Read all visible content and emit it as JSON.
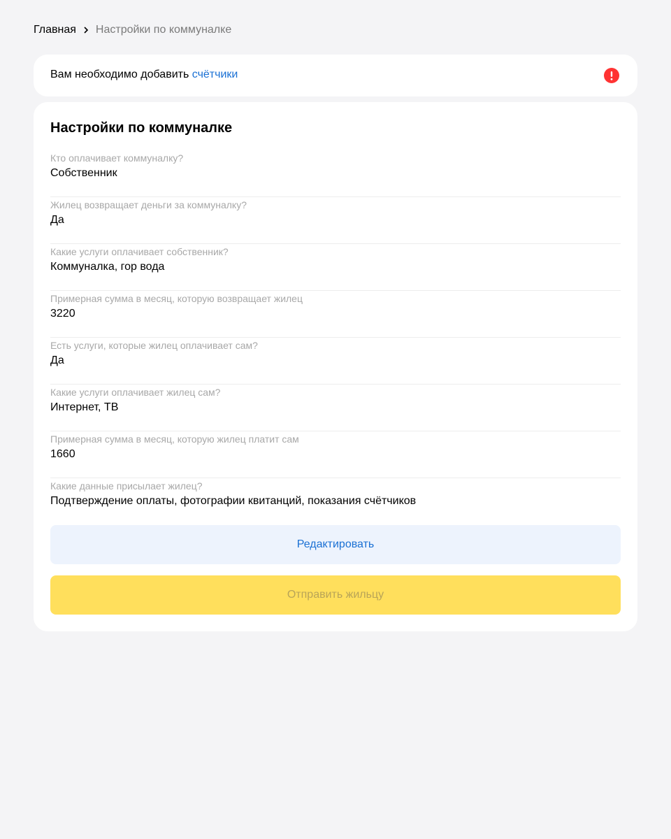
{
  "breadcrumb": {
    "home": "Главная",
    "current": "Настройки по коммуналке"
  },
  "alert": {
    "text": "Вам необходимо добавить ",
    "link": "счётчики",
    "icon": "exclamation-circle-icon",
    "icon_color": "#f33"
  },
  "settings": {
    "title": "Настройки по коммуналке",
    "fields": [
      {
        "label": "Кто оплачивает коммуналку?",
        "value": "Собственник"
      },
      {
        "label": "Жилец возвращает деньги за коммуналку?",
        "value": "Да"
      },
      {
        "label": "Какие услуги оплачивает собственник?",
        "value": "Коммуналка, гор вода"
      },
      {
        "label": "Примерная сумма в месяц, которую возвращает жилец",
        "value": "3220"
      },
      {
        "label": "Есть услуги, которые жилец оплачивает сам?",
        "value": "Да"
      },
      {
        "label": "Какие услуги оплачивает жилец сам?",
        "value": "Интернет, ТВ"
      },
      {
        "label": "Примерная сумма в месяц, которую жилец платит сам",
        "value": "1660"
      },
      {
        "label": "Какие данные присылает жилец?",
        "value": "Подтверждение оплаты, фотографии квитанций, показания счётчиков"
      }
    ],
    "edit_button": "Редактировать",
    "send_button": "Отправить жильцу"
  },
  "colors": {
    "accent": "#1a70d4",
    "primary_button": "#ffdf5c",
    "background": "#f4f4f6"
  }
}
